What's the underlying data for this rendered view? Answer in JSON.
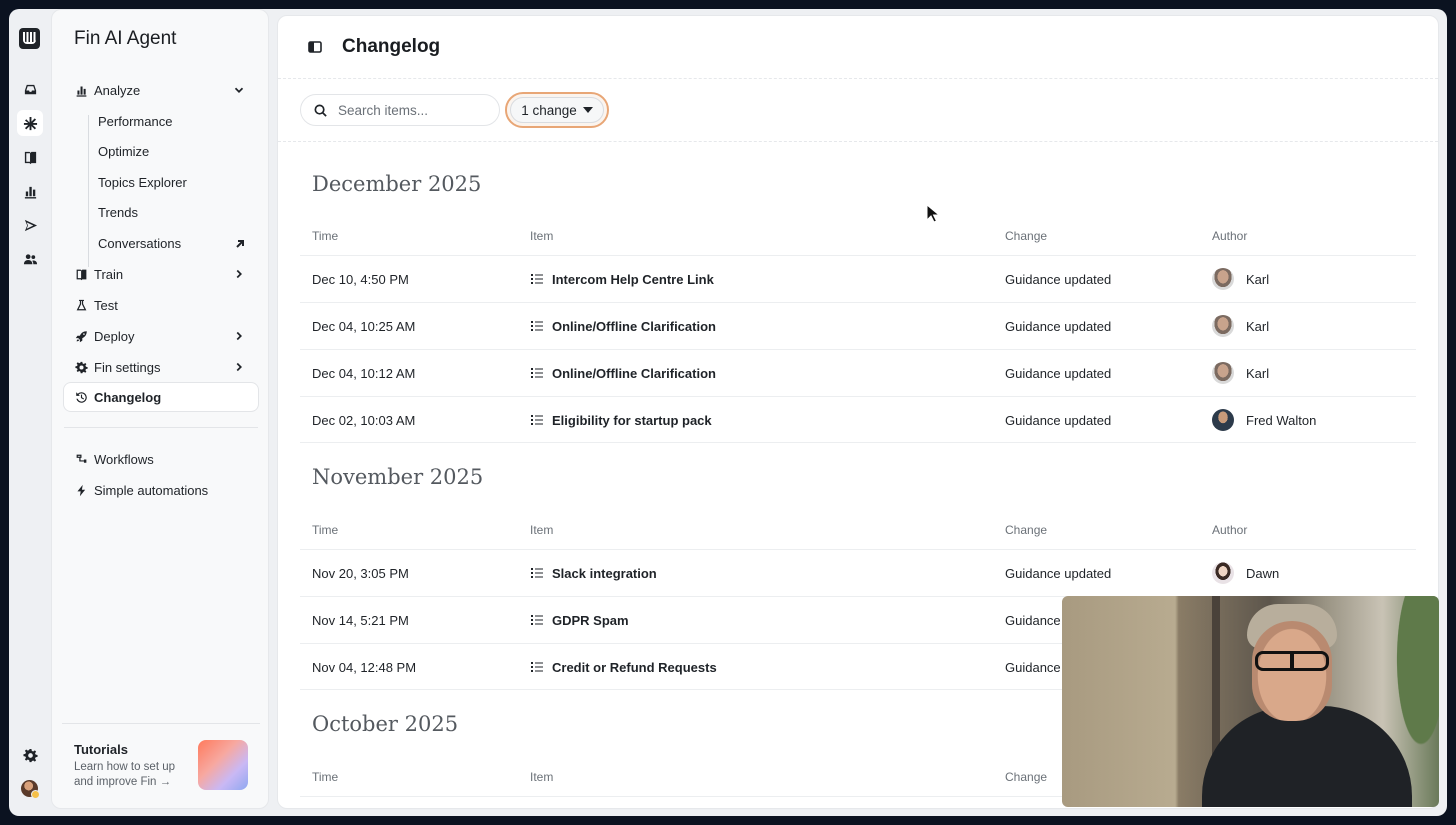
{
  "sidebar": {
    "title": "Fin AI Agent",
    "nav": {
      "analyze": "Analyze",
      "analyze_items": [
        "Performance",
        "Optimize",
        "Topics Explorer",
        "Trends",
        "Conversations"
      ],
      "train": "Train",
      "test": "Test",
      "deploy": "Deploy",
      "fin_settings": "Fin settings",
      "changelog": "Changelog",
      "workflows": "Workflows",
      "simple_automations": "Simple automations"
    },
    "tutorials": {
      "title": "Tutorials",
      "description": "Learn how to set up and improve Fin →"
    }
  },
  "header": {
    "title": "Changelog"
  },
  "toolbar": {
    "search_placeholder": "Search items...",
    "filter_label": "1 change"
  },
  "columns": {
    "time": "Time",
    "item": "Item",
    "change": "Change",
    "author": "Author"
  },
  "sections": [
    {
      "month": "December 2025",
      "rows": [
        {
          "time": "Dec 10, 4:50 PM",
          "item": "Intercom Help Centre Link",
          "change": "Guidance updated",
          "author": "Karl"
        },
        {
          "time": "Dec 04, 10:25 AM",
          "item": "Online/Offline Clarification",
          "change": "Guidance updated",
          "author": "Karl"
        },
        {
          "time": "Dec 04, 10:12 AM",
          "item": "Online/Offline Clarification",
          "change": "Guidance updated",
          "author": "Karl"
        },
        {
          "time": "Dec 02, 10:03 AM",
          "item": "Eligibility for startup pack",
          "change": "Guidance updated",
          "author": "Fred Walton"
        }
      ]
    },
    {
      "month": "November 2025",
      "rows": [
        {
          "time": "Nov 20, 3:05 PM",
          "item": "Slack integration",
          "change": "Guidance updated",
          "author": "Dawn"
        },
        {
          "time": "Nov 14, 5:21 PM",
          "item": "GDPR Spam",
          "change": "Guidance updated",
          "author": ""
        },
        {
          "time": "Nov 04, 12:48 PM",
          "item": "Credit or Refund Requests",
          "change": "Guidance updated",
          "author": ""
        }
      ]
    },
    {
      "month": "October 2025",
      "rows": []
    }
  ]
}
